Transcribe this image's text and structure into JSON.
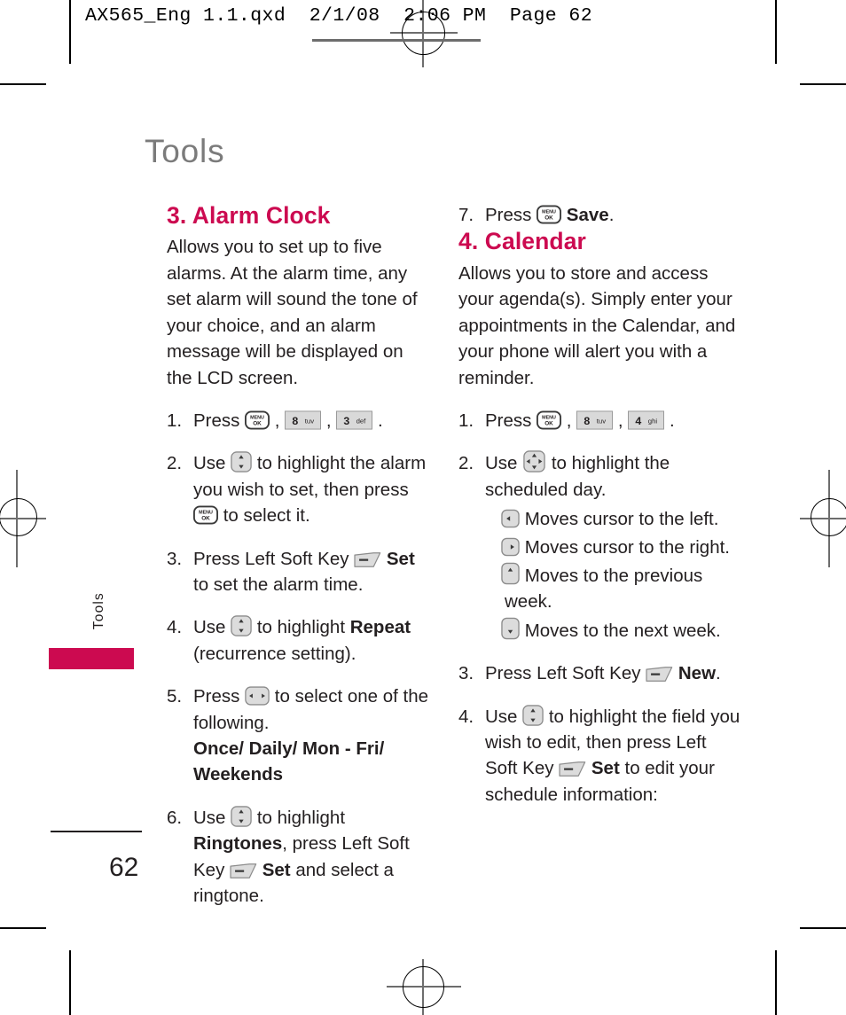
{
  "prepress": {
    "header_text": "AX565_Eng 1.1.qxd  2/1/08  2:06 PM  Page 62"
  },
  "chapter": {
    "title": "Tools",
    "side_tab_label": "Tools"
  },
  "footer": {
    "page_number": "62"
  },
  "left_column": {
    "section": {
      "heading": "3. Alarm Clock",
      "intro": "Allows you to set up to five alarms. At the alarm time, any set alarm will sound the tone of your choice, and an alarm message will be displayed on the LCD screen."
    },
    "steps": [
      {
        "num": "1.",
        "parts": [
          {
            "type": "text",
            "value": "Press "
          },
          {
            "type": "icon",
            "value": "menu-ok-key"
          },
          {
            "type": "text",
            "value": " , "
          },
          {
            "type": "icon",
            "value": "keypad-8-tuv"
          },
          {
            "type": "text",
            "value": " , "
          },
          {
            "type": "icon",
            "value": "keypad-3-def"
          },
          {
            "type": "text",
            "value": " ."
          }
        ]
      },
      {
        "num": "2.",
        "parts": [
          {
            "type": "text",
            "value": "Use "
          },
          {
            "type": "icon",
            "value": "up-down-key"
          },
          {
            "type": "text",
            "value": " to highlight the alarm you wish to set, then press "
          },
          {
            "type": "icon",
            "value": "menu-ok-key"
          },
          {
            "type": "text",
            "value": " to select it."
          }
        ]
      },
      {
        "num": "3.",
        "parts": [
          {
            "type": "text",
            "value": "Press Left Soft Key "
          },
          {
            "type": "icon",
            "value": "left-soft-key"
          },
          {
            "type": "bold",
            "value": " Set"
          },
          {
            "type": "text",
            "value": " to set the alarm time."
          }
        ]
      },
      {
        "num": "4.",
        "parts": [
          {
            "type": "text",
            "value": "Use "
          },
          {
            "type": "icon",
            "value": "up-down-key"
          },
          {
            "type": "text",
            "value": " to highlight "
          },
          {
            "type": "bold",
            "value": "Repeat"
          },
          {
            "type": "text",
            "value": " (recurrence setting)."
          }
        ]
      },
      {
        "num": "5.",
        "parts": [
          {
            "type": "text",
            "value": "Press "
          },
          {
            "type": "icon",
            "value": "left-right-key"
          },
          {
            "type": "text",
            "value": " to select one of the following."
          },
          {
            "type": "bold-block",
            "value": "Once/ Daily/ Mon - Fri/ Weekends"
          }
        ]
      },
      {
        "num": "6.",
        "parts": [
          {
            "type": "text",
            "value": "Use "
          },
          {
            "type": "icon",
            "value": "up-down-key"
          },
          {
            "type": "text",
            "value": " to highlight "
          },
          {
            "type": "bold",
            "value": "Ringtones"
          },
          {
            "type": "text",
            "value": ", press Left Soft Key "
          },
          {
            "type": "icon",
            "value": "left-soft-key"
          },
          {
            "type": "bold",
            "value": " Set"
          },
          {
            "type": "text",
            "value": " and select a ringtone."
          }
        ]
      }
    ]
  },
  "right_column": {
    "step_seven": {
      "num": "7.",
      "parts": [
        {
          "type": "text",
          "value": "Press "
        },
        {
          "type": "icon",
          "value": "menu-ok-key"
        },
        {
          "type": "bold",
          "value": " Save"
        },
        {
          "type": "text",
          "value": "."
        }
      ]
    },
    "section": {
      "heading": "4. Calendar",
      "intro": "Allows you to store and access your agenda(s). Simply enter your appointments in the Calendar, and your phone will alert you with a reminder."
    },
    "steps": [
      {
        "num": "1.",
        "parts": [
          {
            "type": "text",
            "value": "Press "
          },
          {
            "type": "icon",
            "value": "menu-ok-key"
          },
          {
            "type": "text",
            "value": " , "
          },
          {
            "type": "icon",
            "value": "keypad-8-tuv"
          },
          {
            "type": "text",
            "value": " , "
          },
          {
            "type": "icon",
            "value": "keypad-4-ghi"
          },
          {
            "type": "text",
            "value": " ."
          }
        ]
      },
      {
        "num": "2.",
        "parts": [
          {
            "type": "text",
            "value": "Use "
          },
          {
            "type": "icon",
            "value": "four-way-key"
          },
          {
            "type": "text",
            "value": " to highlight the scheduled day."
          }
        ]
      },
      {
        "num": "3.",
        "parts": [
          {
            "type": "text",
            "value": "Press Left Soft Key "
          },
          {
            "type": "icon",
            "value": "left-soft-key"
          },
          {
            "type": "bold",
            "value": " New"
          },
          {
            "type": "text",
            "value": "."
          }
        ]
      },
      {
        "num": "4.",
        "parts": [
          {
            "type": "text",
            "value": "Use "
          },
          {
            "type": "icon",
            "value": "up-down-key"
          },
          {
            "type": "text",
            "value": " to highlight the field you wish to edit, then press Left Soft Key "
          },
          {
            "type": "icon",
            "value": "left-soft-key"
          },
          {
            "type": "bold",
            "value": " Set"
          },
          {
            "type": "text",
            "value": " to edit your schedule information:"
          }
        ]
      }
    ],
    "key_descriptions": [
      {
        "icon": "arrow-left-key",
        "text": "Moves cursor to the left."
      },
      {
        "icon": "arrow-right-key",
        "text": "Moves cursor to the right."
      },
      {
        "icon": "arrow-up-key",
        "text": "Moves to the previous week."
      },
      {
        "icon": "arrow-down-key",
        "text": "Moves to the next week."
      }
    ]
  },
  "keypad_icons": {
    "menu-ok-key": {
      "line1": "MENU",
      "line2": "OK"
    },
    "keypad-8-tuv": {
      "digit": "8",
      "letters": "tuv"
    },
    "keypad-3-def": {
      "digit": "3",
      "letters": "def"
    },
    "keypad-4-ghi": {
      "digit": "4",
      "letters": "ghi"
    }
  },
  "colors": {
    "accent": "#cc0a50",
    "chapter_title": "#7b7b7b",
    "body_text": "#231f20",
    "key_fill": "#d9d9d9"
  }
}
